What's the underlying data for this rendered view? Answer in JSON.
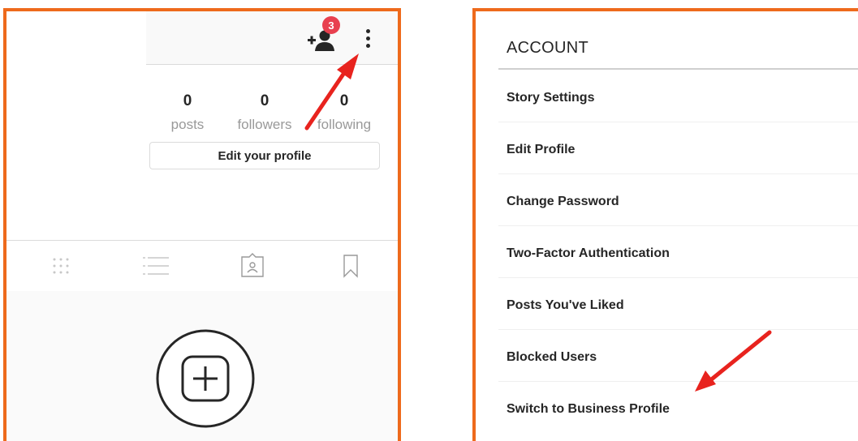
{
  "colors": {
    "frame": "#ee6a1c",
    "arrow": "#e8231e",
    "badge": "#e8404f"
  },
  "left_panel": {
    "notification_badge": "3",
    "stats": {
      "posts": {
        "value": "0",
        "label": "posts"
      },
      "followers": {
        "value": "0",
        "label": "followers"
      },
      "following": {
        "value": "0",
        "label": "following"
      }
    },
    "edit_profile_label": "Edit your profile",
    "tabs": [
      "grid-icon",
      "list-icon",
      "tagged-icon",
      "bookmark-icon"
    ],
    "icons": {
      "add_user": "add-user-icon",
      "options": "kebab-menu-icon",
      "add_post": "add-post-icon"
    }
  },
  "right_panel": {
    "header": "ACCOUNT",
    "items": [
      "Story Settings",
      "Edit Profile",
      "Change Password",
      "Two-Factor Authentication",
      "Posts You've Liked",
      "Blocked Users",
      "Switch to Business Profile"
    ]
  }
}
